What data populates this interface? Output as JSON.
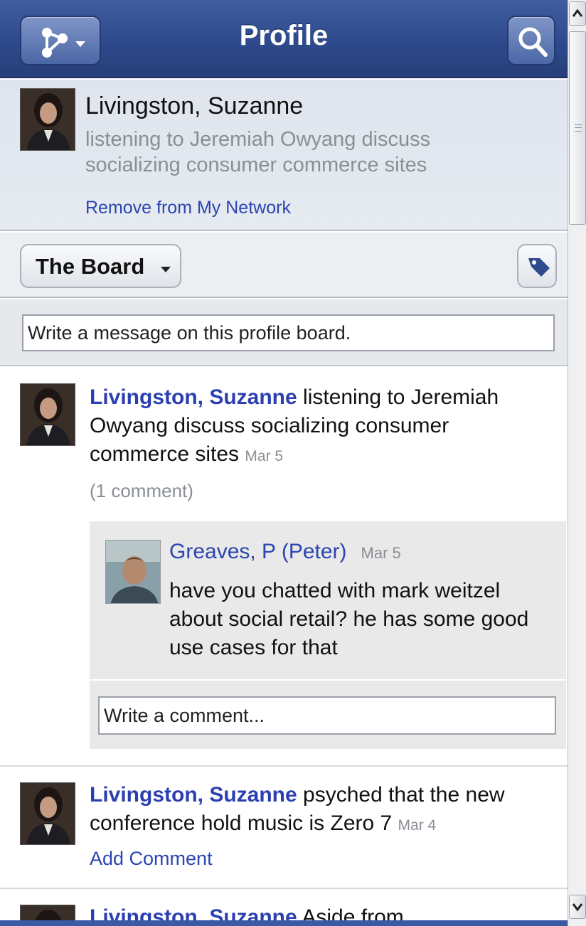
{
  "header": {
    "title": "Profile",
    "menu_icon": "network-menu-icon",
    "search_icon": "search-icon"
  },
  "profile": {
    "name": "Livingston, Suzanne",
    "status": "listening to Jeremiah Owyang discuss socializing consumer commerce sites",
    "remove_link": "Remove from My Network"
  },
  "board": {
    "selector_label": "The Board",
    "tag_icon": "tag-icon",
    "message_placeholder": "Write a message on this profile board."
  },
  "posts": [
    {
      "author": "Livingston, Suzanne",
      "text": " listening to Jeremiah Owyang discuss socializing consumer commerce sites ",
      "date": "Mar 5",
      "comment_count": "(1 comment)",
      "comments": [
        {
          "author": "Greaves, P (Peter)",
          "date": "Mar 5",
          "text": "have you chatted with mark weitzel about social retail? he has some good use cases for that"
        }
      ],
      "comment_placeholder": "Write a comment..."
    },
    {
      "author": "Livingston, Suzanne",
      "text": " psyched that the new conference hold music is Zero 7 ",
      "date": "Mar 4",
      "add_comment": "Add Comment"
    },
    {
      "author": "Livingston, Suzanne",
      "text": " Aside from"
    }
  ],
  "colors": {
    "header": "#2e4a8c",
    "link": "#2c45b0",
    "author": "#2c3fb0"
  }
}
